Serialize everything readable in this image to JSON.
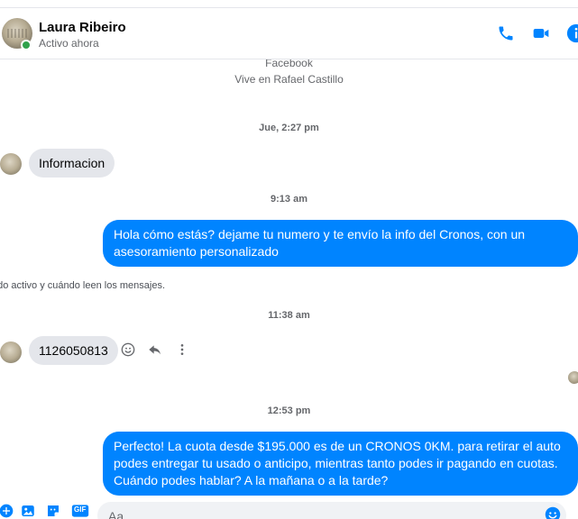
{
  "header": {
    "name": "Laura Ribeiro",
    "status": "Activo ahora",
    "icons": [
      "phone-icon",
      "video-camera-icon",
      "info-icon"
    ]
  },
  "intro": {
    "line1": "Facebook",
    "line2": "Vive en Rafael Castillo"
  },
  "conversation": {
    "ts1": "Jue, 2:27 pm",
    "msg1": "Informacion",
    "ts2": "9:13 am",
    "msg2": "Hola cómo estás? dejame tu numero  y te envío la info del Cronos, con un asesoramiento personalizado",
    "system_notice": "Ahora pueden llamarse y ver su estado activo y cuándo leen los mensajes.",
    "ts3": "11:38 am",
    "msg3": "1126050813",
    "ts4": "12:53 pm",
    "msg4": "Perfecto! La cuota desde $195.000 es de un CRONOS 0KM. para retirar el auto podes entregar tu usado o anticipo, mientras tanto podes ir pagando en cuotas. Cuándo podes hablar? A la mañana o a la tarde?"
  },
  "composer": {
    "placeholder": "Aa",
    "gif_label": "GIF"
  },
  "colors": {
    "accent": "#0084ff",
    "incoming_bubble": "#e4e6eb",
    "online": "#31a24c"
  }
}
